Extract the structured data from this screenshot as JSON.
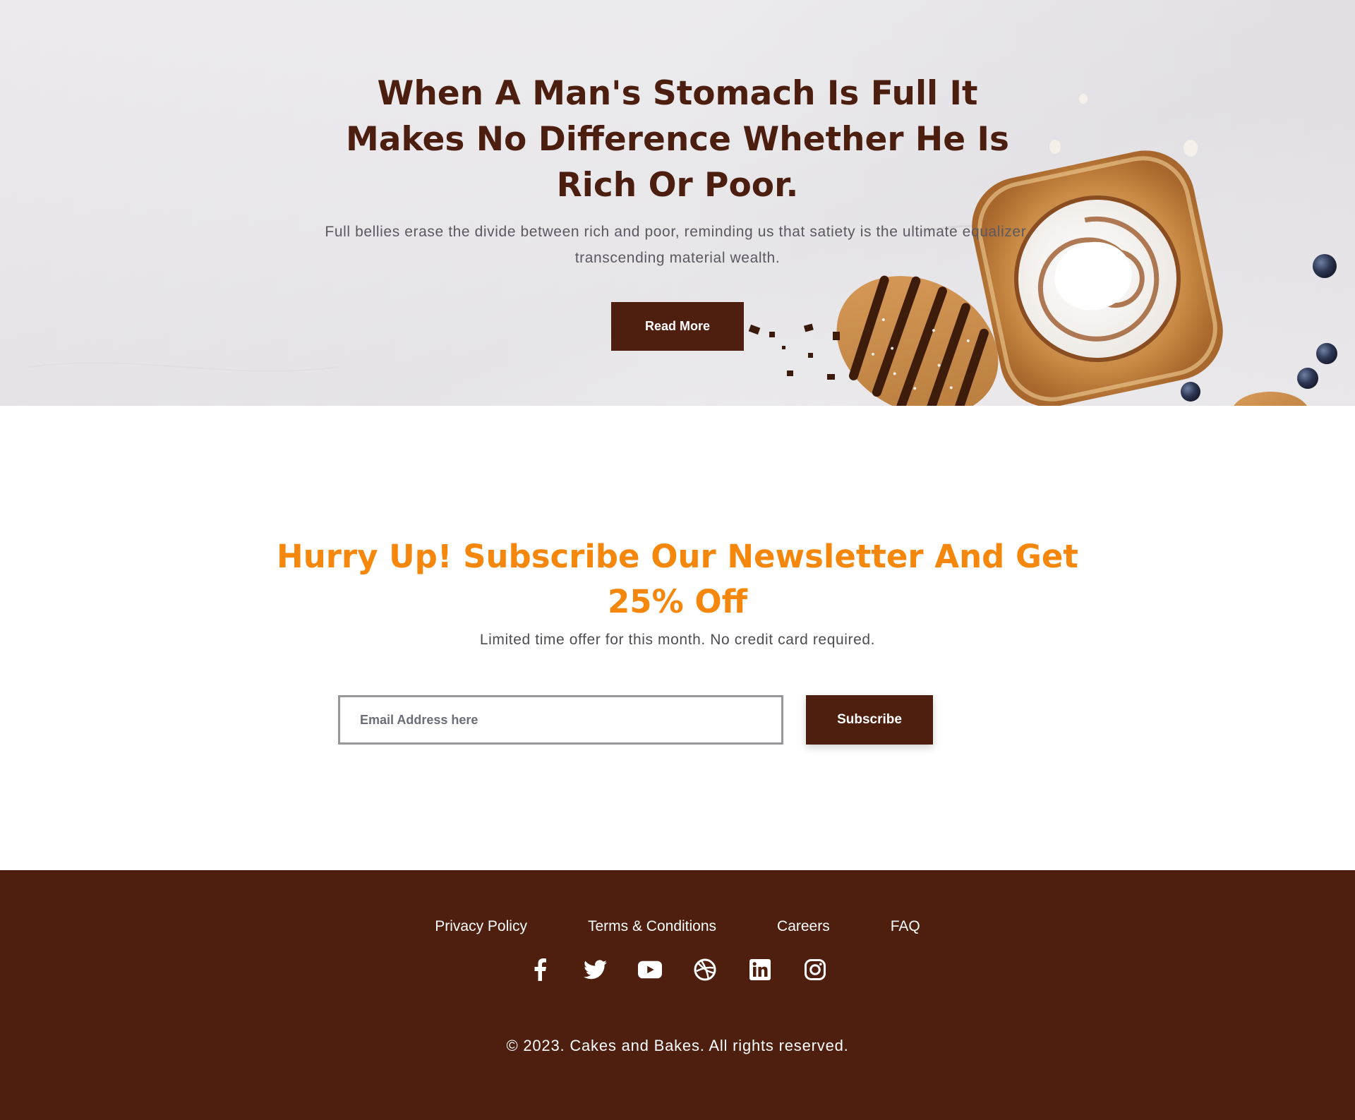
{
  "hero": {
    "title": "When A Man's Stomach Is Full It Makes No Difference Whether He Is Rich Or Poor.",
    "text": "Full bellies erase the divide between rich and poor, reminding us that satiety is the ultimate equalizer, transcending material wealth.",
    "button_label": "Read More",
    "image": "pastries-on-marble"
  },
  "newsletter": {
    "title": "Hurry Up! Subscribe Our Newsletter And Get 25% Off",
    "subtitle": "Limited time offer for this month. No credit card required.",
    "email_placeholder": "Email Address here",
    "email_value": "",
    "button_label": "Subscribe"
  },
  "footer": {
    "links": [
      "Privacy Policy",
      "Terms & Conditions",
      "Careers",
      "FAQ"
    ],
    "social_icons": [
      "facebook-icon",
      "twitter-icon",
      "youtube-icon",
      "dribbble-icon",
      "linkedin-icon",
      "instagram-icon"
    ],
    "copyright": "© 2023. Cakes and Bakes. All rights reserved."
  },
  "colors": {
    "brand_brown": "#4e1f0f",
    "heading_brown": "#4b1e0f",
    "accent_orange": "#f5870d",
    "footer_bg": "#4e1f0f"
  }
}
